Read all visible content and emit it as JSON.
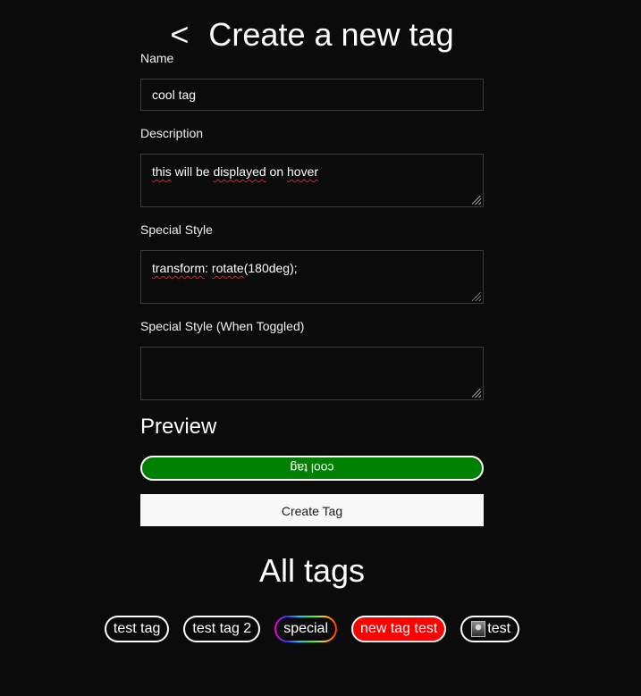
{
  "header": {
    "back_label": "<",
    "title": "Create a new tag"
  },
  "form": {
    "name": {
      "label": "Name",
      "value": "cool tag"
    },
    "description": {
      "label": "Description",
      "value_parts": [
        "this",
        " will be ",
        "displayed",
        " on ",
        "hover"
      ]
    },
    "special_style": {
      "label": "Special Style",
      "value_parts": [
        "transform",
        ": ",
        "rotate",
        "(180deg);"
      ]
    },
    "special_style_toggled": {
      "label": "Special Style (When Toggled)",
      "value": ""
    }
  },
  "preview": {
    "heading": "Preview",
    "tag_label": "cool tag",
    "tag_color": "#008000"
  },
  "create_button_label": "Create Tag",
  "all_tags": {
    "heading": "All tags",
    "tags": [
      {
        "label": "test tag"
      },
      {
        "label": "test tag 2"
      },
      {
        "label": "special"
      },
      {
        "label": "new tag test"
      },
      {
        "label": "test"
      }
    ]
  },
  "colors": {
    "background": "#0b0b0b",
    "input_border": "#3a3a3a",
    "red_tag": "#ff0000",
    "preview_green": "#008000"
  }
}
